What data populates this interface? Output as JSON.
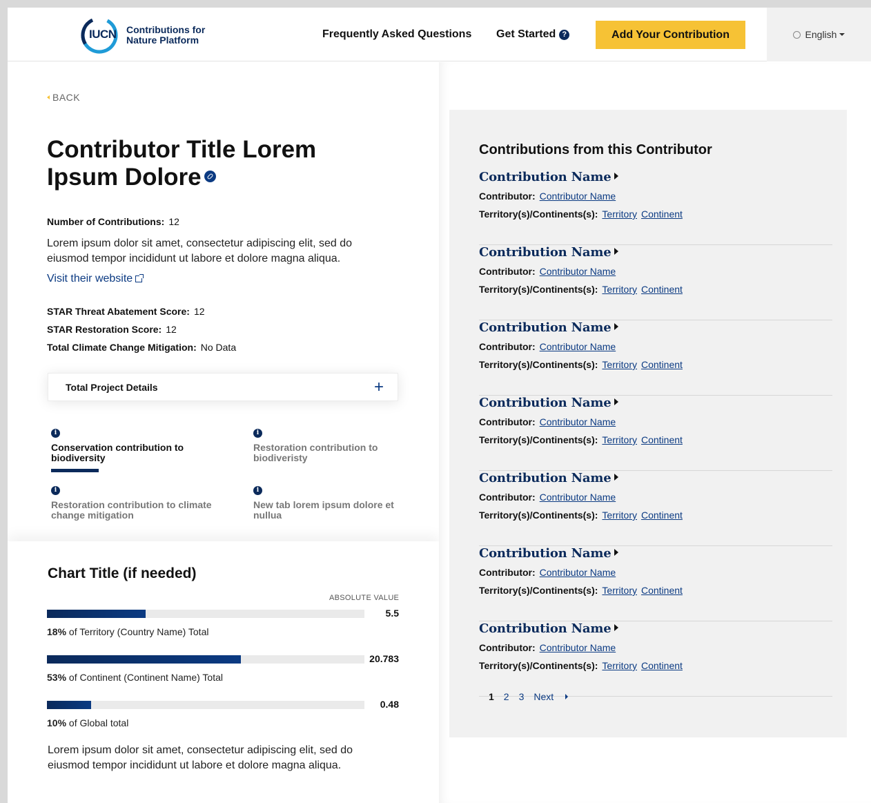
{
  "header": {
    "logo_mark": "IUCN",
    "logo_text": "Contributions for Nature Platform",
    "nav_faq": "Frequently Asked Questions",
    "nav_get_started": "Get Started",
    "get_started_icon": "?",
    "add_button": "Add Your Contribution",
    "language": "English"
  },
  "left": {
    "back_label": "BACK",
    "title": "Contributor Title Lorem Ipsum Dolore",
    "num_contrib_label": "Number of Contributions:",
    "num_contrib_value": "12",
    "description": "Lorem ipsum dolor sit amet, consectetur adipiscing elit, sed do eiusmod tempor incididunt ut labore et dolore magna aliqua.",
    "visit_link": "Visit their website",
    "scores": [
      {
        "label": "STAR Threat Abatement Score:",
        "value": "12"
      },
      {
        "label": "STAR Restoration Score:",
        "value": "12"
      },
      {
        "label": "Total Climate Change Mitigation:",
        "value": "No Data"
      }
    ],
    "accordion_label": "Total Project Details",
    "accordion_icon": "+",
    "tabs": [
      {
        "label": "Conservation contribution to biodiversity",
        "active": true
      },
      {
        "label": "Restoration contribution to biodiveristy",
        "active": false
      },
      {
        "label": "Restoration contribution to climate change mitigation",
        "active": false
      },
      {
        "label": "New tab lorem ipsum dolore et nullua",
        "active": false
      }
    ],
    "info_glyph": "i"
  },
  "chart": {
    "title": "Chart Title (if needed)",
    "value_header": "ABSOLUTE VALUE",
    "description": "Lorem ipsum dolor sit amet, consectetur adipiscing elit, sed do eiusmod tempor incididunt ut labore et dolore magna aliqua."
  },
  "chart_data": {
    "type": "bar",
    "title": "Chart Title (if needed)",
    "categories": [
      "of Territory (Country Name) Total",
      "of Continent (Continent Name) Total",
      "of Global total"
    ],
    "percent_labels": [
      "18%",
      "53%",
      "10%"
    ],
    "fill_percent": [
      31,
      61,
      14
    ],
    "values": [
      5.5,
      20.783,
      0.48
    ],
    "value_labels": [
      "5.5",
      "20.783",
      "0.48"
    ]
  },
  "right": {
    "title": "Contributions from this Contributor",
    "contributor_label": "Contributor:",
    "territory_label": "Territory(s)/Continents(s):",
    "items": [
      {
        "name": "Contribution Name",
        "contributor": "Contributor Name",
        "territory": "Territory",
        "continent": "Continent"
      },
      {
        "name": "Contribution Name",
        "contributor": "Contributor Name",
        "territory": "Territory",
        "continent": "Continent"
      },
      {
        "name": "Contribution Name",
        "contributor": "Contributor Name",
        "territory": "Territory",
        "continent": "Continent"
      },
      {
        "name": "Contribution Name",
        "contributor": "Contributor Name",
        "territory": "Territory",
        "continent": "Continent"
      },
      {
        "name": "Contribution Name",
        "contributor": "Contributor Name",
        "territory": "Territory",
        "continent": "Continent"
      },
      {
        "name": "Contribution Name",
        "contributor": "Contributor Name",
        "territory": "Territory",
        "continent": "Continent"
      },
      {
        "name": "Contribution Name",
        "contributor": "Contributor Name",
        "territory": "Territory",
        "continent": "Continent"
      }
    ],
    "pagination": {
      "current": "1",
      "pages": [
        "2",
        "3"
      ],
      "next": "Next"
    }
  },
  "colors": {
    "accent": "#f6c235",
    "brand": "#0b2a5b",
    "link": "#0b3a82",
    "panel": "#f1f1f1"
  }
}
